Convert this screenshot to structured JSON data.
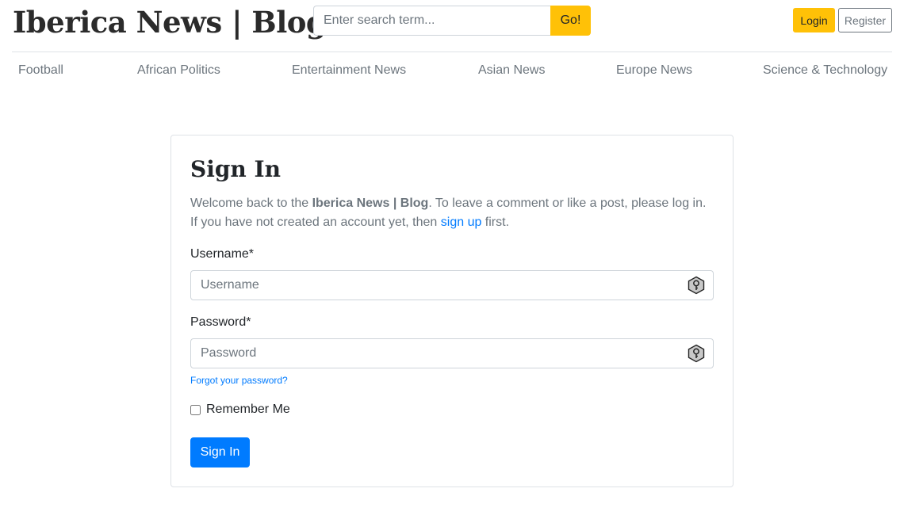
{
  "header": {
    "brand": "Iberica News | Blog",
    "search": {
      "placeholder": "Enter search term...",
      "button_label": "Go!"
    },
    "login_label": "Login",
    "register_label": "Register"
  },
  "nav": {
    "items": [
      {
        "label": "Football"
      },
      {
        "label": "African Politics"
      },
      {
        "label": "Entertainment News"
      },
      {
        "label": "Asian News"
      },
      {
        "label": "Europe News"
      },
      {
        "label": "Science & Technology"
      }
    ]
  },
  "signin": {
    "title": "Sign In",
    "intro_before": "Welcome back to the ",
    "intro_brand": "Iberica News | Blog",
    "intro_middle": ". To leave a comment or like a post, please log in. If you have not created an account yet, then ",
    "intro_link": "sign up",
    "intro_after": " first.",
    "username_label": "Username*",
    "username_placeholder": "Username",
    "password_label": "Password*",
    "password_placeholder": "Password",
    "forgot_link": "Forgot your password?",
    "remember_label": "Remember Me",
    "submit_label": "Sign In"
  },
  "colors": {
    "accent_yellow": "#ffc107",
    "primary_blue": "#007bff",
    "muted_text": "#6c757d",
    "border": "#dee2e6"
  },
  "icons": {
    "field_icon": "key-icon"
  }
}
